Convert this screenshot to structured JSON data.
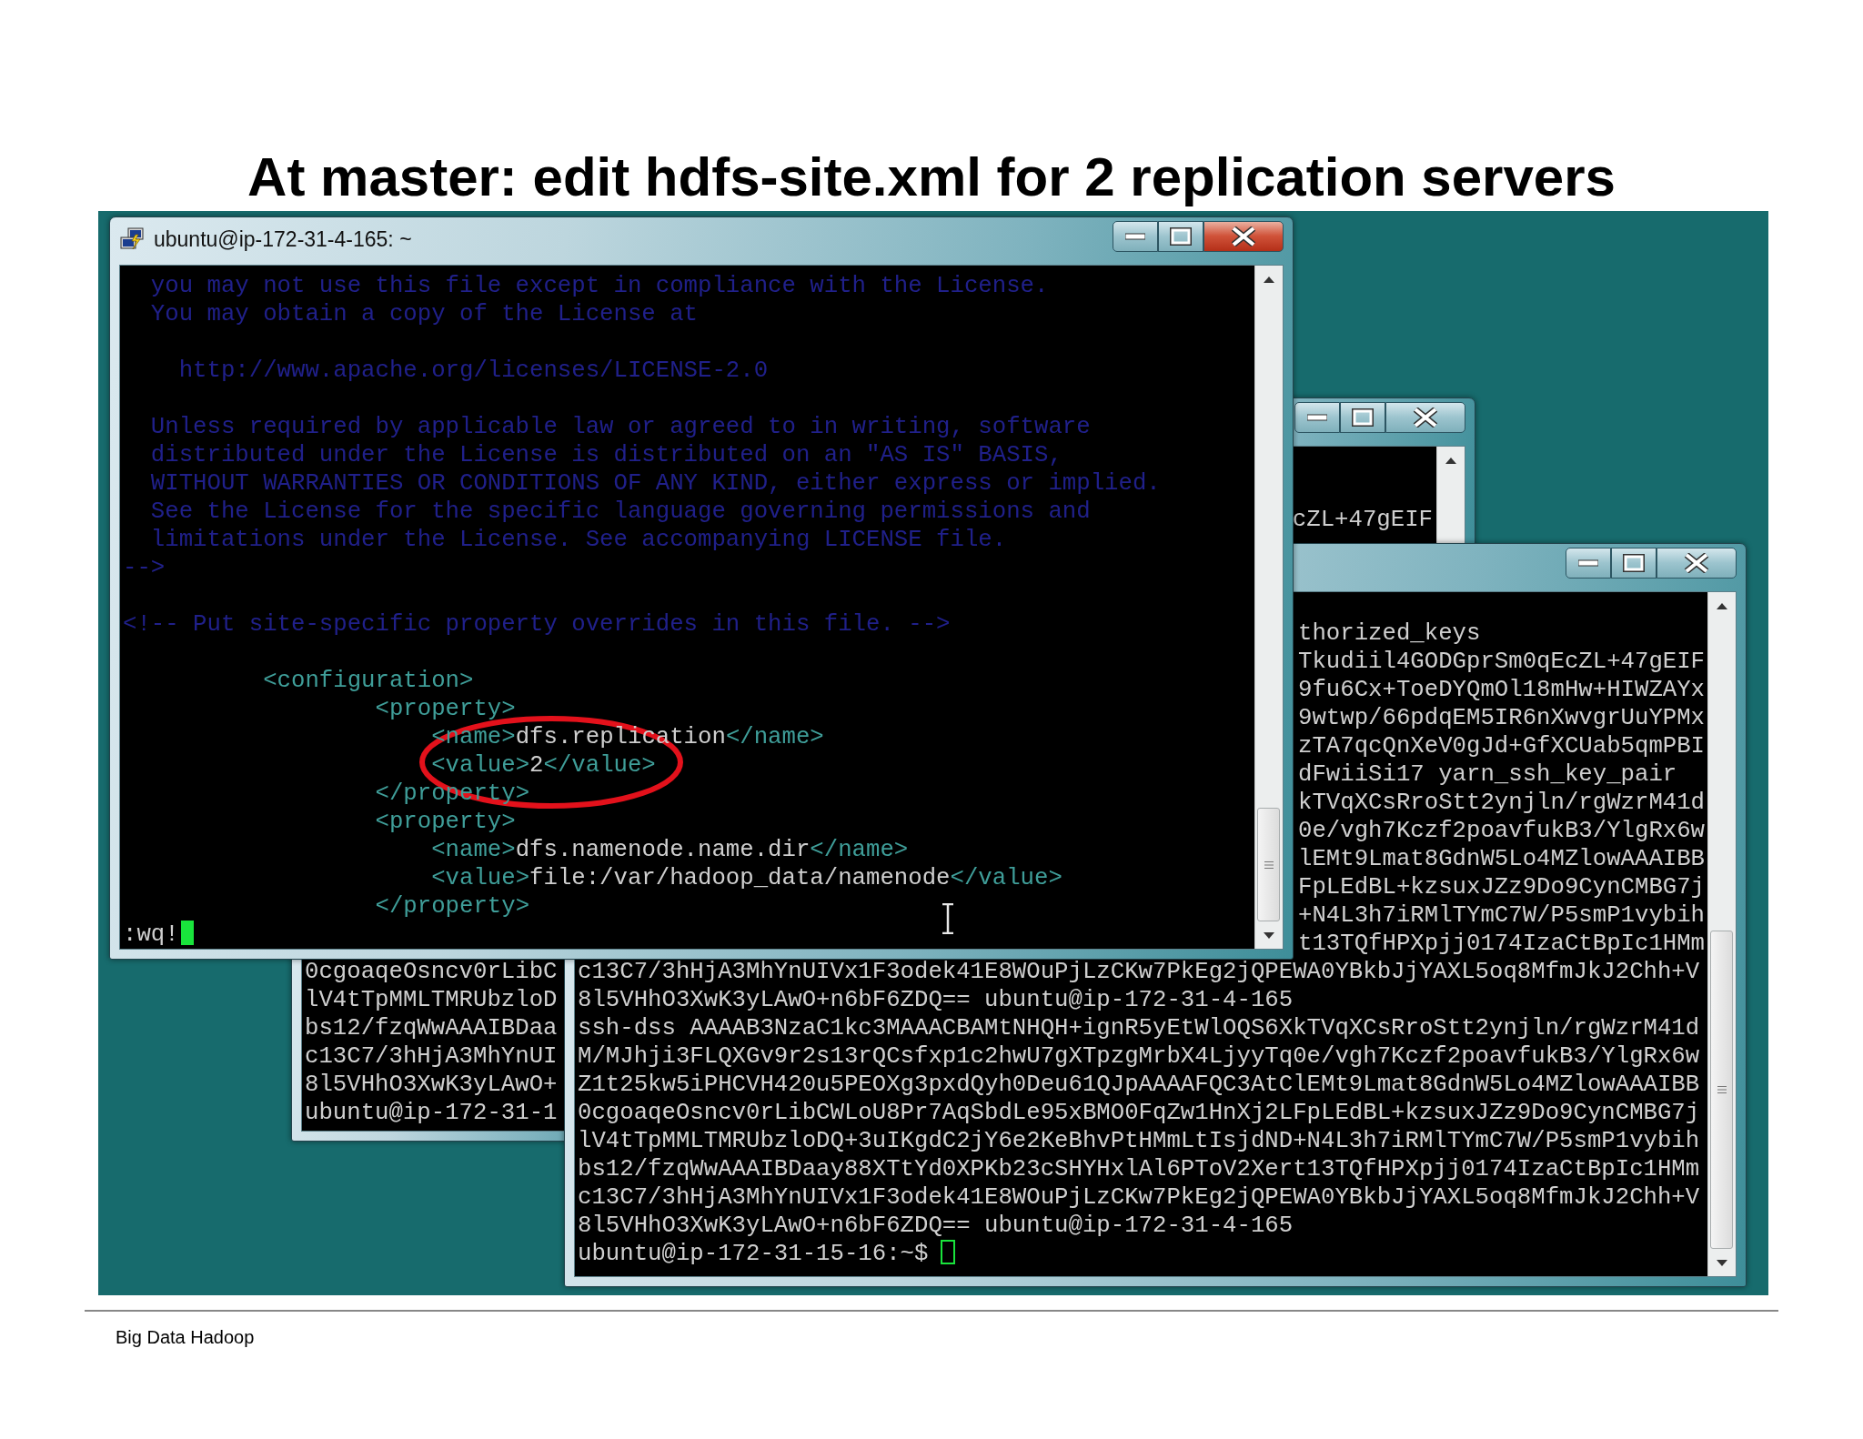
{
  "slide": {
    "title": "At master: edit hdfs-site.xml for 2 replication servers",
    "footer": "Big Data Hadoop"
  },
  "windows": [
    {
      "kind": "main",
      "title": "ubuntu@ip-172-31-4-165: ~",
      "lines": [
        {
          "kind": "comment",
          "text": "  you may not use this file except in compliance with the License."
        },
        {
          "kind": "comment",
          "text": "  You may obtain a copy of the License at"
        },
        {
          "kind": "blank"
        },
        {
          "kind": "comment",
          "text": "    http://www.apache.org/licenses/LICENSE-2.0"
        },
        {
          "kind": "blank"
        },
        {
          "kind": "comment",
          "text": "  Unless required by applicable law or agreed to in writing, software"
        },
        {
          "kind": "comment",
          "text": "  distributed under the License is distributed on an \"AS IS\" BASIS,"
        },
        {
          "kind": "comment",
          "text": "  WITHOUT WARRANTIES OR CONDITIONS OF ANY KIND, either express or implied."
        },
        {
          "kind": "comment",
          "text": "  See the License for the specific language governing permissions and"
        },
        {
          "kind": "comment",
          "text": "  limitations under the License. See accompanying LICENSE file."
        },
        {
          "kind": "comment",
          "text": "-->"
        },
        {
          "kind": "blank"
        },
        {
          "kind": "comment",
          "text": "<!-- Put site-specific property overrides in this file. -->"
        },
        {
          "kind": "blank"
        },
        {
          "kind": "xml",
          "text": "          <configuration>"
        },
        {
          "kind": "xml",
          "text": "                  <property>"
        },
        {
          "kind": "xml",
          "text": "                      <name>dfs.replication</name>"
        },
        {
          "kind": "xml",
          "text": "                      <value>2</value>"
        },
        {
          "kind": "xml",
          "text": "                  </property>"
        },
        {
          "kind": "xml",
          "text": "                  <property>"
        },
        {
          "kind": "xml",
          "text": "                      <name>dfs.namenode.name.dir</name>"
        },
        {
          "kind": "xml",
          "text": "                      <value>file:/var/hadoop_data/namenode</value>"
        },
        {
          "kind": "xml",
          "text": "                  </property>"
        },
        {
          "kind": "command",
          "text": ":wq!"
        }
      ]
    },
    {
      "kind": "upper",
      "lines": [
        {
          "kind": "fragment",
          "text": "cZL+47gEIF"
        }
      ]
    },
    {
      "kind": "lower",
      "lines": [
        {
          "kind": "fragment",
          "text": "thorized_keys"
        },
        {
          "kind": "fragment",
          "text": "Tkudiil4GODGprSm0qEcZL+47gEIF"
        },
        {
          "kind": "fragment",
          "text": "9fu6Cx+ToeDYQmOl18mHw+HIWZAYx"
        },
        {
          "kind": "fragment",
          "text": "9wtwp/66pdqEM5IR6nXwvgrUuYPMx"
        },
        {
          "kind": "fragment",
          "text": "zTA7qcQnXeV0gJd+GfXCUab5qmPBI"
        },
        {
          "kind": "fragment",
          "text": "dFwiiSi17 yarn_ssh_key_pair"
        },
        {
          "kind": "fragment",
          "text": "kTVqXCsRroStt2ynjln/rgWzrM41d"
        },
        {
          "kind": "fragment",
          "text": "0e/vgh7Kczf2poavfukB3/YlgRx6w"
        },
        {
          "kind": "fragment",
          "text": "lEMt9Lmat8GdnW5Lo4MZlowAAAIBB"
        },
        {
          "kind": "fragment",
          "text": "FpLEdBL+kzsuxJZz9Do9CynCMBG7j"
        },
        {
          "kind": "fragment",
          "text": "+N4L3h7iRMlTYmC7W/P5smP1vybih"
        },
        {
          "kind": "fragment",
          "text": "t13TQfHPXpjj0174IzaCtBpIc1HMm"
        },
        {
          "kind": "text",
          "text": "c13C7/3hHjA3MhYnUIVx1F3odek41E8WOuPjLzCKw7PkEg2jQPEWA0YBkbJjYAXL5oq8MfmJkJ2Chh+V"
        },
        {
          "kind": "text",
          "text": "8l5VHhO3XwK3yLAwO+n6bF6ZDQ== ubuntu@ip-172-31-4-165"
        },
        {
          "kind": "text",
          "text": "ssh-dss AAAAB3NzaC1kc3MAAACBAMtNHQH+ignR5yEtWlOQS6XkTVqXCsRroStt2ynjln/rgWzrM41d"
        },
        {
          "kind": "text",
          "text": "M/MJhji3FLQXGv9r2s13rQCsfxp1c2hwU7gXTpzgMrbX4LjyyTq0e/vgh7Kczf2poavfukB3/YlgRx6w"
        },
        {
          "kind": "text",
          "text": "Z1t25kw5iPHCVH420u5PEOXg3pxdQyh0Deu61QJpAAAAFQC3AtClEMt9Lmat8GdnW5Lo4MZlowAAAIBB"
        },
        {
          "kind": "text",
          "text": "0cgoaqeOsncv0rLibCWLoU8Pr7AqSbdLe95xBMO0FqZw1HnXj2LFpLEdBL+kzsuxJZz9Do9CynCMBG7j"
        },
        {
          "kind": "text",
          "text": "lV4tTpMMLTMRUbzloDQ+3uIKgdC2jY6e2KeBhvPtHMmLtIsjdND+N4L3h7iRMlTYmC7W/P5smP1vybih"
        },
        {
          "kind": "text",
          "text": "bs12/fzqWwAAAIBDaay88XTtYd0XPKb23cSHYHxlAl6PToV2Xert13TQfHPXpjj0174IzaCtBpIc1HMm"
        },
        {
          "kind": "text",
          "text": "c13C7/3hHjA3MhYnUIVx1F3odek41E8WOuPjLzCKw7PkEg2jQPEWA0YBkbJjYAXL5oq8MfmJkJ2Chh+V"
        },
        {
          "kind": "text",
          "text": "8l5VHhO3XwK3yLAwO+n6bF6ZDQ== ubuntu@ip-172-31-4-165"
        },
        {
          "kind": "prompt",
          "text": "ubuntu@ip-172-31-15-16:~$"
        }
      ]
    },
    {
      "kind": "left",
      "lines": [
        {
          "kind": "text",
          "text": "0cgoaqeOsncv0rLibC"
        },
        {
          "kind": "text",
          "text": "lV4tTpMMLTMRUbzloD"
        },
        {
          "kind": "text",
          "text": "bs12/fzqWwAAAIBDaa"
        },
        {
          "kind": "text",
          "text": "c13C7/3hHjA3MhYnUI"
        },
        {
          "kind": "text",
          "text": "8l5VHhO3XwK3yLAwO+"
        },
        {
          "kind": "text",
          "text": "ubuntu@ip-172-31-1"
        }
      ]
    }
  ]
}
